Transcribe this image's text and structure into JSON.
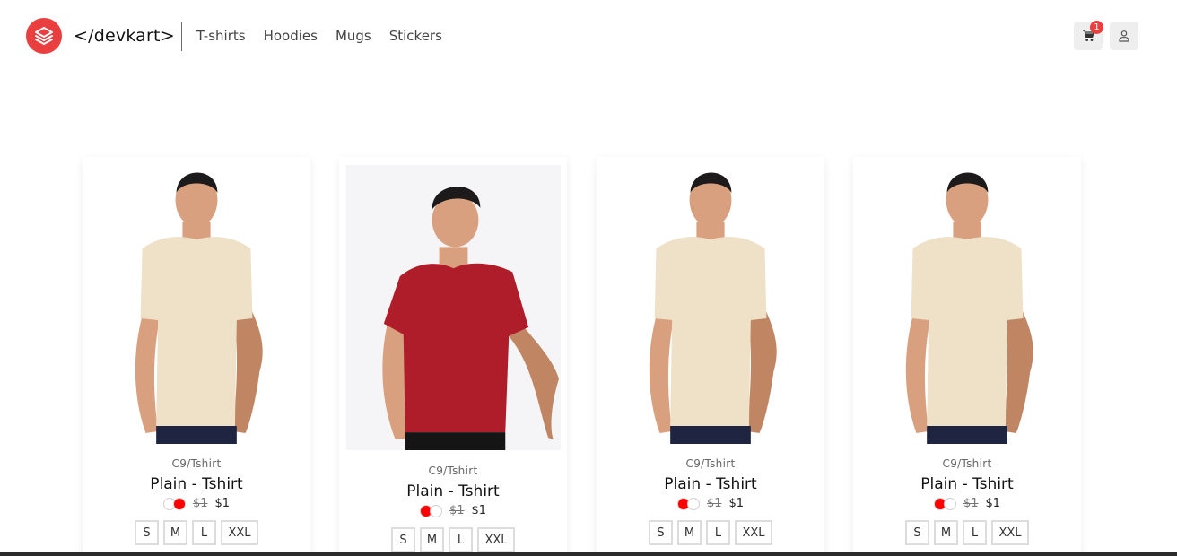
{
  "header": {
    "brand": "</devkart>",
    "nav": [
      "T-shirts",
      "Hoodies",
      "Mugs",
      "Stickers"
    ],
    "cart_count": "1",
    "icons": {
      "logo": "layers-icon",
      "cart": "cart-icon",
      "user": "user-icon"
    },
    "colors": {
      "brand": "#e93f3f"
    }
  },
  "products": [
    {
      "category": "C9/Tshirt",
      "name": "Plain - Tshirt",
      "colors": [
        "#ffffff",
        "#ff0000"
      ],
      "old_price": "$1",
      "price": "$1",
      "sizes": [
        "S",
        "M",
        "L",
        "XXL"
      ],
      "shirt_color": "#eee1c8"
    },
    {
      "category": "C9/Tshirt",
      "name": "Plain - Tshirt",
      "colors": [
        "#ff0000",
        "#ffffff"
      ],
      "old_price": "$1",
      "price": "$1",
      "sizes": [
        "S",
        "M",
        "L",
        "XXL"
      ],
      "shirt_color": "#b01d2a"
    },
    {
      "category": "C9/Tshirt",
      "name": "Plain - Tshirt",
      "colors": [
        "#ff0000",
        "#ffffff"
      ],
      "old_price": "$1",
      "price": "$1",
      "sizes": [
        "S",
        "M",
        "L",
        "XXL"
      ],
      "shirt_color": "#eee1c8"
    },
    {
      "category": "C9/Tshirt",
      "name": "Plain - Tshirt",
      "colors": [
        "#ff0000",
        "#ffffff"
      ],
      "old_price": "$1",
      "price": "$1",
      "sizes": [
        "S",
        "M",
        "L",
        "XXL"
      ],
      "shirt_color": "#eee1c8"
    }
  ]
}
